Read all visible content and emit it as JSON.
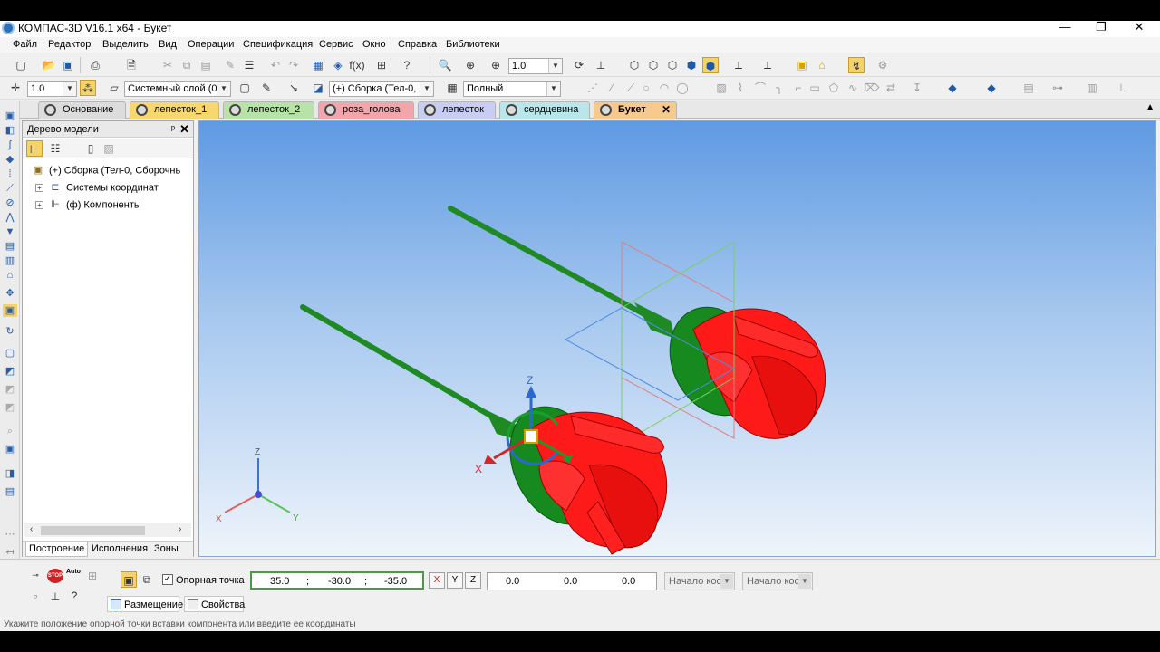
{
  "window": {
    "title": "КОМПАС-3D V16.1 x64 - Букет",
    "minimize": "—",
    "maximize": "❐",
    "close": "✕"
  },
  "menu": [
    "Файл",
    "Редактор",
    "Выделить",
    "Вид",
    "Операции",
    "Спецификация",
    "Сервис",
    "Окно",
    "Справка",
    "Библиотеки"
  ],
  "toolbar1": {
    "zoom_value": "1.0"
  },
  "toolbar2": {
    "step_value": "1.0",
    "layer_combo": "Системный слой (0)",
    "assembly_combo": "(+) Сборка (Тел-0, С",
    "display_mode_combo": "Полный"
  },
  "doc_tabs": [
    {
      "label": "Основание",
      "color": "#dcdcdc"
    },
    {
      "label": "лепесток_1",
      "color": "#f6d86e"
    },
    {
      "label": "лепесток_2",
      "color": "#b7e3a6"
    },
    {
      "label": "роза_голова",
      "color": "#f2a6ab"
    },
    {
      "label": "лепесток",
      "color": "#c8cdf3"
    },
    {
      "label": "сердцевина",
      "color": "#b8e6ea"
    },
    {
      "label": "Букет",
      "color": "#f8c98c",
      "active": true,
      "close": "✕"
    }
  ],
  "tree_panel": {
    "title": "Дерево модели",
    "pin": "ᵖ",
    "close": "✕",
    "items": [
      {
        "label": "(+) Сборка (Тел-0, Сборочнь",
        "expander": ""
      },
      {
        "label": "Системы координат",
        "expander": "+"
      },
      {
        "label": "(ф) Компоненты",
        "expander": "+"
      }
    ],
    "tabs": [
      "Построение",
      "Исполнения",
      "Зоны"
    ]
  },
  "viewport": {
    "axis_labels": {
      "z": "Z",
      "x": "X",
      "y": "Y"
    }
  },
  "property_bar": {
    "stop_label": "STOP",
    "auto_label": "Auto",
    "base_point_checkbox": "✓",
    "base_point_label": "Опорная точка",
    "coords": [
      "35.0",
      "-30.0",
      "-35.0"
    ],
    "separators": [
      ";",
      ";"
    ],
    "rotate_buttons": [
      "X",
      "Y",
      "Z"
    ],
    "angles": [
      "0.0",
      "0.0",
      "0.0"
    ],
    "origin_combo_1": "Начало коо",
    "origin_combo_2": "Начало коо",
    "tabs": [
      "Размещение",
      "Свойства"
    ]
  },
  "status_text": "Укажите положение опорной точки вставки компонента или введите ее координаты"
}
